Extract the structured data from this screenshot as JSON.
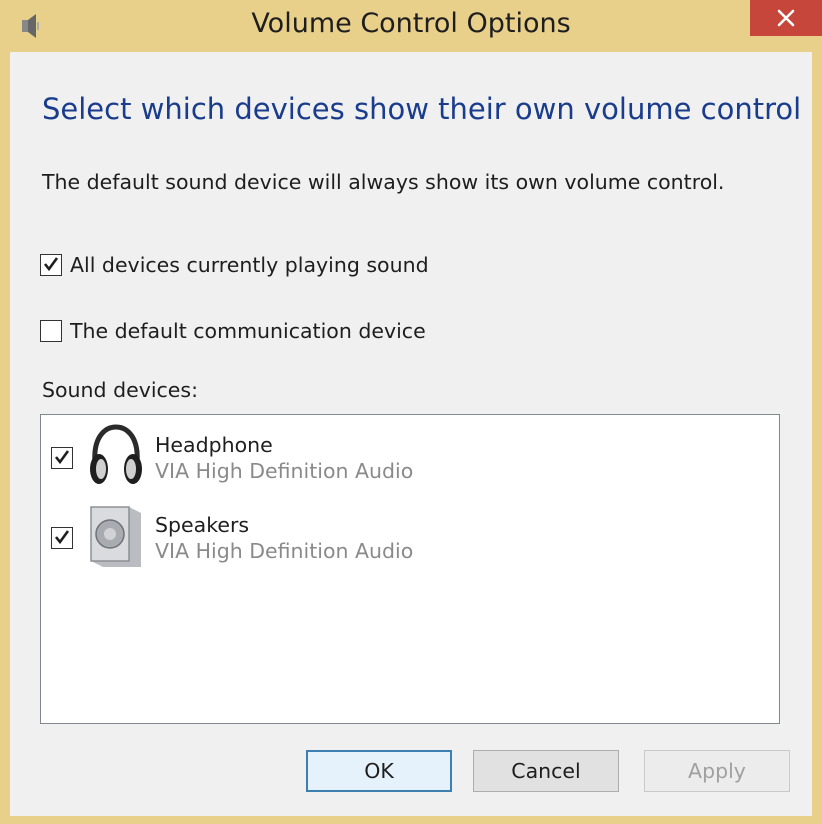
{
  "window": {
    "title": "Volume Control Options",
    "icon": "speaker-icon",
    "close_icon": "close-icon",
    "accent_close": "#c7463c",
    "frame_color": "#e8cf8a"
  },
  "dialog": {
    "heading": "Select which devices show their own volume control",
    "description": "The default sound device will always show its own volume control.",
    "options": [
      {
        "label": "All devices currently playing sound",
        "checked": true
      },
      {
        "label": "The default communication device",
        "checked": false
      }
    ],
    "devices_label": "Sound devices:",
    "devices": [
      {
        "name": "Headphone",
        "driver": "VIA High Definition Audio",
        "checked": true,
        "icon": "headphone-icon"
      },
      {
        "name": "Speakers",
        "driver": "VIA High Definition Audio",
        "checked": true,
        "icon": "speakers-icon"
      }
    ]
  },
  "buttons": {
    "ok": "OK",
    "cancel": "Cancel",
    "apply": "Apply",
    "apply_enabled": false
  },
  "colors": {
    "heading": "#1a3c8c",
    "secondary_text": "#8a8a8a",
    "default_button_border": "#3c7fb1"
  }
}
